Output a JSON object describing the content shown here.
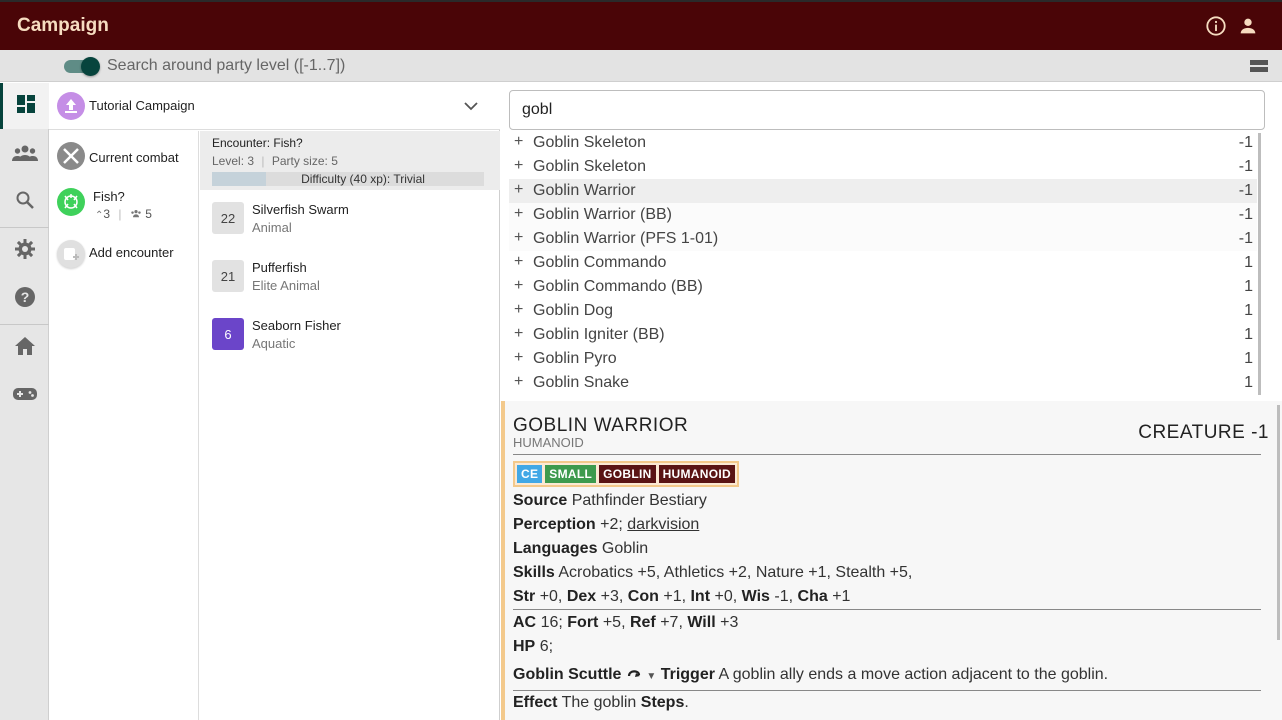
{
  "app": {
    "title": "Campaign",
    "search_toggle_label": "Search around party level ([-1..7])"
  },
  "nav": {
    "items": [
      "dashboard",
      "party",
      "search",
      "settings",
      "help",
      "home",
      "games"
    ]
  },
  "campaign": {
    "name": "Tutorial Campaign"
  },
  "encounters": {
    "current_combat": "Current combat",
    "items": [
      {
        "name": "Fish?",
        "level": "3",
        "party": "5"
      }
    ],
    "add_label": "Add encounter"
  },
  "encounter_detail": {
    "title": "Encounter: Fish?",
    "level_text": "Level: 3",
    "party_text": "Party size: 5",
    "difficulty_text": "Difficulty (40 xp): Trivial",
    "difficulty_fill": 0.2,
    "creatures": [
      {
        "count": "22",
        "name": "Silverfish Swarm",
        "type": "Animal"
      },
      {
        "count": "21",
        "name": "Pufferfish",
        "type": "Elite Animal"
      },
      {
        "count": "6",
        "name": "Seaborn Fisher",
        "type": "Aquatic"
      }
    ]
  },
  "search": {
    "value": "gobl",
    "results": [
      {
        "name": "Goblin Skeleton",
        "level": "-1"
      },
      {
        "name": "Goblin Skeleton",
        "level": "-1"
      },
      {
        "name": "Goblin Warrior",
        "level": "-1"
      },
      {
        "name": "Goblin Warrior (BB)",
        "level": "-1"
      },
      {
        "name": "Goblin Warrior (PFS 1-01)",
        "level": "-1"
      },
      {
        "name": "Goblin Commando",
        "level": "1"
      },
      {
        "name": "Goblin Commando (BB)",
        "level": "1"
      },
      {
        "name": "Goblin Dog",
        "level": "1"
      },
      {
        "name": "Goblin Igniter (BB)",
        "level": "1"
      },
      {
        "name": "Goblin Pyro",
        "level": "1"
      },
      {
        "name": "Goblin Snake",
        "level": "1"
      }
    ]
  },
  "statblock": {
    "name": "GOBLIN WARRIOR",
    "family": "HUMANOID",
    "level_text": "CREATURE -1",
    "traits": [
      {
        "label": "CE",
        "color": "#41a8e6"
      },
      {
        "label": "SMALL",
        "color": "#3d9a4d"
      },
      {
        "label": "GOBLIN",
        "color": "#5a1414"
      },
      {
        "label": "HUMANOID",
        "color": "#5a1414"
      }
    ],
    "source_label": "Source",
    "source": "Pathfinder Bestiary",
    "perception_label": "Perception",
    "perception": "+2;",
    "perception_sense": "darkvision",
    "languages_label": "Languages",
    "languages": "Goblin",
    "skills_label": "Skills",
    "skills": "Acrobatics +5, Athletics +2, Nature +1, Stealth +5,",
    "abilities": [
      {
        "label": "Str",
        "value": "+0,"
      },
      {
        "label": "Dex",
        "value": "+3,"
      },
      {
        "label": "Con",
        "value": "+1,"
      },
      {
        "label": "Int",
        "value": "+0,"
      },
      {
        "label": "Wis",
        "value": "-1,"
      },
      {
        "label": "Cha",
        "value": "+1"
      }
    ],
    "ac_label": "AC",
    "ac": "16;",
    "fort_label": "Fort",
    "fort": "+5,",
    "ref_label": "Ref",
    "ref": "+7,",
    "will_label": "Will",
    "will": "+3",
    "hp_label": "HP",
    "hp": "6;",
    "reaction_name": "Goblin Scuttle",
    "trigger_label": "Trigger",
    "trigger": "A goblin ally ends a move action adjacent to the goblin.",
    "effect_label": "Effect",
    "effect_pre": "The goblin",
    "effect_bold": "Steps",
    "effect_post": "."
  }
}
